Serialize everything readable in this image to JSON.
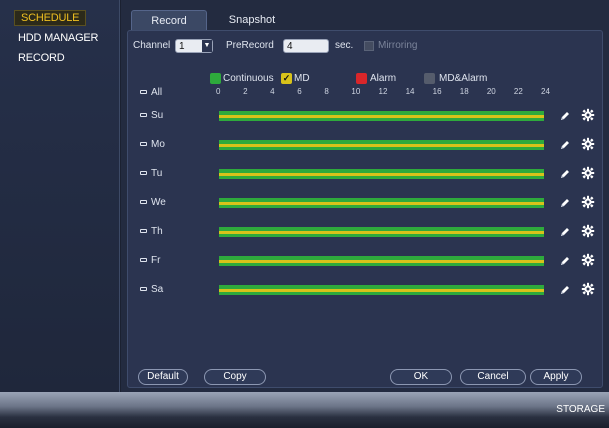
{
  "sidebar": {
    "items": [
      {
        "label": "SCHEDULE",
        "active": true
      },
      {
        "label": "HDD MANAGER",
        "active": false
      },
      {
        "label": "RECORD",
        "active": false
      }
    ]
  },
  "tabs": [
    {
      "label": "Record",
      "active": true
    },
    {
      "label": "Snapshot",
      "active": false
    }
  ],
  "controls": {
    "channel_label": "Channel",
    "channel_value": "1",
    "prerecord_label": "PreRecord",
    "prerecord_value": "4",
    "prerecord_unit": "sec.",
    "mirroring_label": "Mirroring"
  },
  "legend": [
    {
      "label": "Continuous",
      "color": "#2eaa3c",
      "checked": false
    },
    {
      "label": "MD",
      "color": "#d8c21a",
      "checked": true
    },
    {
      "label": "Alarm",
      "color": "#d9262a",
      "checked": false
    },
    {
      "label": "MD&Alarm",
      "color": "#555c6c",
      "checked": false
    }
  ],
  "hour_ticks": [
    "0",
    "2",
    "4",
    "6",
    "8",
    "10",
    "12",
    "14",
    "16",
    "18",
    "20",
    "22",
    "24"
  ],
  "all_label": "All",
  "days": [
    {
      "label": "Su",
      "continuous": [
        0,
        24
      ],
      "md": [
        0,
        24
      ]
    },
    {
      "label": "Mo",
      "continuous": [
        0,
        24
      ],
      "md": [
        0,
        24
      ]
    },
    {
      "label": "Tu",
      "continuous": [
        0,
        24
      ],
      "md": [
        0,
        24
      ]
    },
    {
      "label": "We",
      "continuous": [
        0,
        24
      ],
      "md": [
        0,
        24
      ]
    },
    {
      "label": "Th",
      "continuous": [
        0,
        24
      ],
      "md": [
        0,
        24
      ]
    },
    {
      "label": "Fr",
      "continuous": [
        0,
        24
      ],
      "md": [
        0,
        24
      ]
    },
    {
      "label": "Sa",
      "continuous": [
        0,
        24
      ],
      "md": [
        0,
        24
      ]
    }
  ],
  "buttons": {
    "default": "Default",
    "copy": "Copy",
    "ok": "OK",
    "cancel": "Cancel",
    "apply": "Apply"
  },
  "footer": {
    "storage": "STORAGE"
  }
}
